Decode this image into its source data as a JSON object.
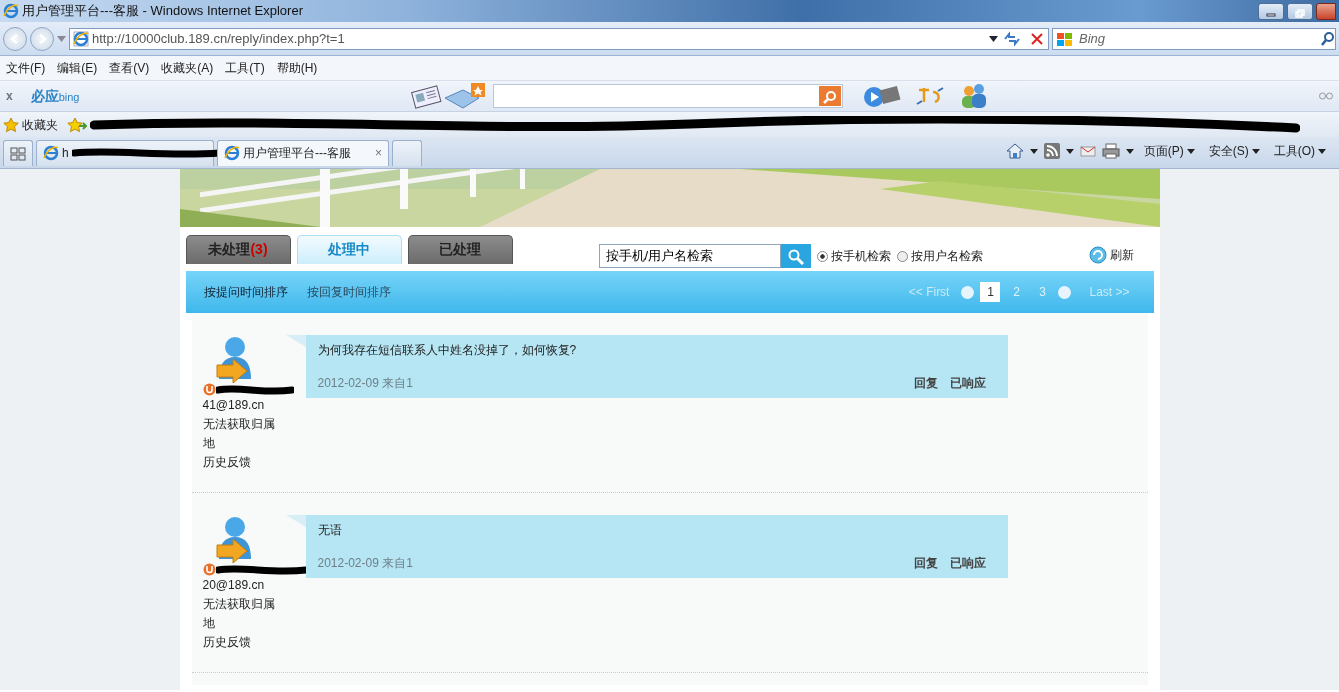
{
  "window": {
    "title": "用户管理平台---客服 - Windows Internet Explorer"
  },
  "address_bar": {
    "url": "http://10000club.189.cn/reply/index.php?t=1"
  },
  "search_box": {
    "placeholder": "Bing"
  },
  "menu": [
    "文件(F)",
    "编辑(E)",
    "查看(V)",
    "收藏夹(A)",
    "工具(T)",
    "帮助(H)"
  ],
  "bing_toolbar": {
    "close": "x",
    "logo": "必应",
    "logo_sub": "bing"
  },
  "favorites_bar": {
    "label": "收藏夹"
  },
  "browser_tabs": [
    {
      "label": "h",
      "selected": false,
      "redacted": true
    },
    {
      "label": "用户管理平台---客服",
      "selected": true,
      "redacted": false,
      "close": "×"
    }
  ],
  "command_bar": [
    "页面(P)",
    "安全(S)",
    "工具(O)"
  ],
  "page": {
    "status_tabs": [
      {
        "label": "未处理",
        "count": "(3)",
        "selected": false
      },
      {
        "label": "处理中",
        "selected": true
      },
      {
        "label": "已处理",
        "selected": false
      }
    ],
    "search": {
      "value": "按手机/用户名检索"
    },
    "search_modes": [
      {
        "label": "按手机检索",
        "selected": true
      },
      {
        "label": "按用户名检索",
        "selected": false
      }
    ],
    "refresh": "刷新",
    "sort_options": [
      {
        "label": "按提问时间排序",
        "selected": true
      },
      {
        "label": "按回复时间排序",
        "selected": false
      }
    ],
    "pagination": {
      "first": "<< First",
      "last": "Last >>",
      "pages": [
        {
          "label": "1",
          "selected": true
        },
        {
          "label": "2",
          "selected": false
        },
        {
          "label": "3",
          "selected": false
        }
      ]
    },
    "messages": [
      {
        "user": "41@189.cn",
        "location": "无法获取归属地",
        "history": "历史反馈",
        "question": "为何我存在短信联系人中姓名没掉了，如何恢复?",
        "meta": "2012-02-09 来自1",
        "actions": [
          "回复",
          "已响应"
        ]
      },
      {
        "user": "20@189.cn",
        "location": "无法获取归属地",
        "history": "历史反馈",
        "question": "无语",
        "meta": "2012-02-09 来自1",
        "actions": [
          "回复",
          "已响应"
        ]
      }
    ]
  }
}
